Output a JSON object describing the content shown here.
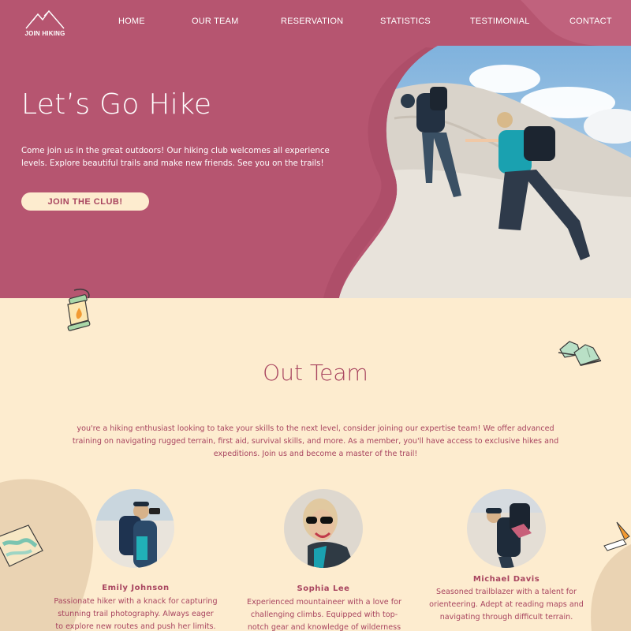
{
  "brand": {
    "logo_text": "JOIN HIKING"
  },
  "nav": {
    "items": [
      {
        "label": "HOME"
      },
      {
        "label": "OUR TEAM"
      },
      {
        "label": "RESERVATION"
      },
      {
        "label": "STATISTICS"
      },
      {
        "label": "TESTIMONIAL"
      },
      {
        "label": "CONTACT"
      }
    ]
  },
  "hero": {
    "title": "Let’s Go Hike",
    "text": "Come join us in the great outdoors! Our hiking club welcomes all experience levels. Explore beautiful trails and make new friends. See you on the trails!",
    "button_label": "JOIN THE CLUB!"
  },
  "team": {
    "title": "Out Team",
    "intro": "you're a hiking enthusiast looking to take your skills to the next level, consider joining our expertise team! We offer advanced training on navigating rugged terrain, first aid, survival skills, and more. As a member, you'll have access to exclusive hikes and expeditions. Join us and become a master of the trail!",
    "members": [
      {
        "name": "Emily Johnson",
        "bio": "Passionate hiker with a knack for capturing stunning trail photography. Always eager to explore new routes and push her limits."
      },
      {
        "name": "Sophia Lee",
        "bio": "Experienced mountaineer with a love for challenging climbs. Equipped with top-notch gear and knowledge of wilderness survival."
      },
      {
        "name": "Michael Davis",
        "bio": "Seasoned trailblazer with a talent for orienteering. Adept at reading maps and navigating through difficult terrain."
      }
    ]
  },
  "colors": {
    "hero_bg": "#b65570",
    "cream": "#fdeccf",
    "accent_text": "#a8445f",
    "sand_blob": "#ead3b3"
  },
  "icons": [
    "mountain-logo-icon",
    "lantern-icon",
    "hiking-boots-icon",
    "map-icon",
    "pocket-knife-icon"
  ]
}
